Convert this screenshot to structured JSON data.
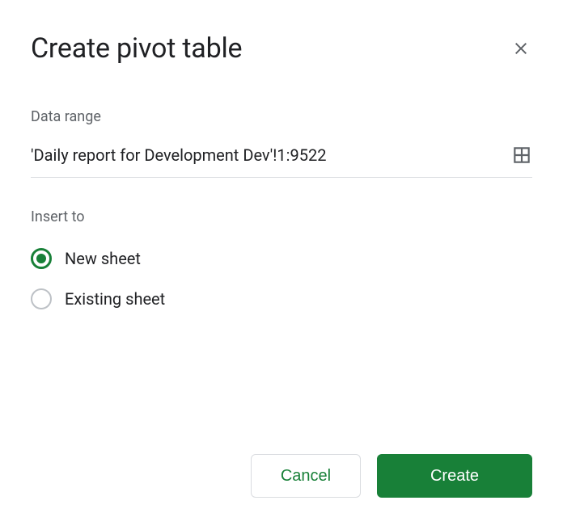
{
  "dialog": {
    "title": "Create pivot table",
    "dataRange": {
      "label": "Data range",
      "value": "'Daily report for Development Dev'!1:9522"
    },
    "insertTo": {
      "label": "Insert to",
      "options": {
        "newSheet": "New sheet",
        "existingSheet": "Existing sheet"
      }
    },
    "buttons": {
      "cancel": "Cancel",
      "create": "Create"
    }
  }
}
